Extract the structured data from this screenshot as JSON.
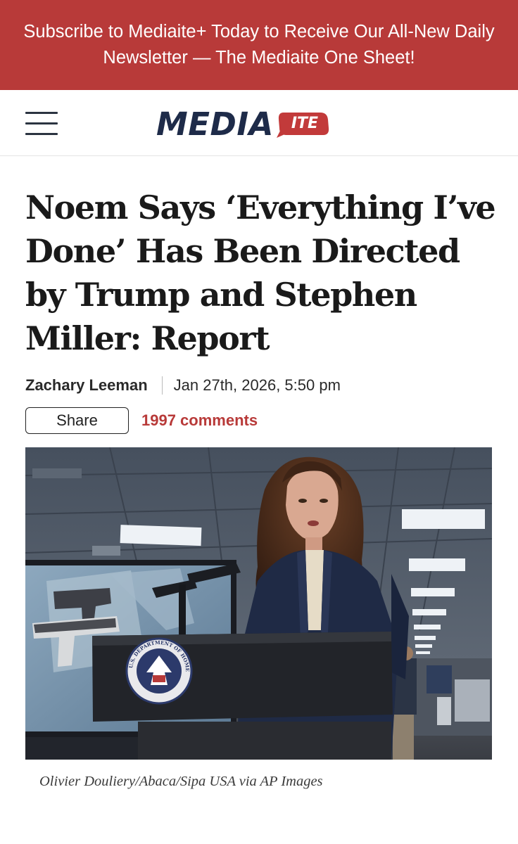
{
  "promo_banner": {
    "text": "Subscribe to Mediaite+ Today to Receive Our All-New Daily Newsletter — The Mediaite One Sheet!",
    "background_color": "#b83a39"
  },
  "header": {
    "menu_icon": "hamburger-menu-icon",
    "logo_main": "MEDIA",
    "logo_badge": "ITE",
    "logo_color": "#1e2b49",
    "badge_color": "#c23a3a"
  },
  "article": {
    "headline": "Noem Says ‘Everything I’ve Done’ Has Been Directed by Trump and Stephen Miller: Report",
    "author": "Zachary Leeman",
    "date": "Jan 27th, 2026, 5:50 pm",
    "share_label": "Share",
    "comments": "1997 comments",
    "accent_color": "#b83a39",
    "seal_text": "U.S. DEPARTMENT OF HOMELAND SECURITY",
    "photo_caption": "Olivier Douliery/Abaca/Sipa USA via AP Images"
  }
}
